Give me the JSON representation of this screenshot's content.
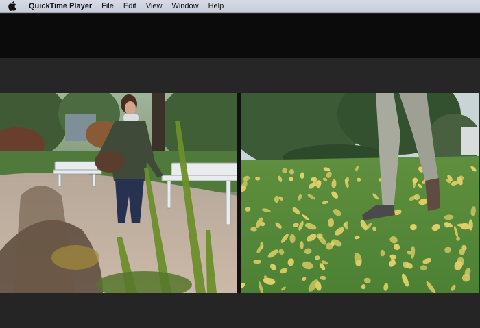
{
  "menubar": {
    "apple_icon": "apple-logo-icon",
    "app_name": "QuickTime Player",
    "items": [
      "File",
      "Edit",
      "View",
      "Window",
      "Help"
    ]
  },
  "video": {
    "left_scene": "woman walking on park path past benches",
    "right_scene": "walking legs on grass with yellow leaves"
  },
  "colors": {
    "menubar_bg": "#d3d8e2",
    "window_top": "#0b0b0b",
    "window_body": "#262626"
  }
}
